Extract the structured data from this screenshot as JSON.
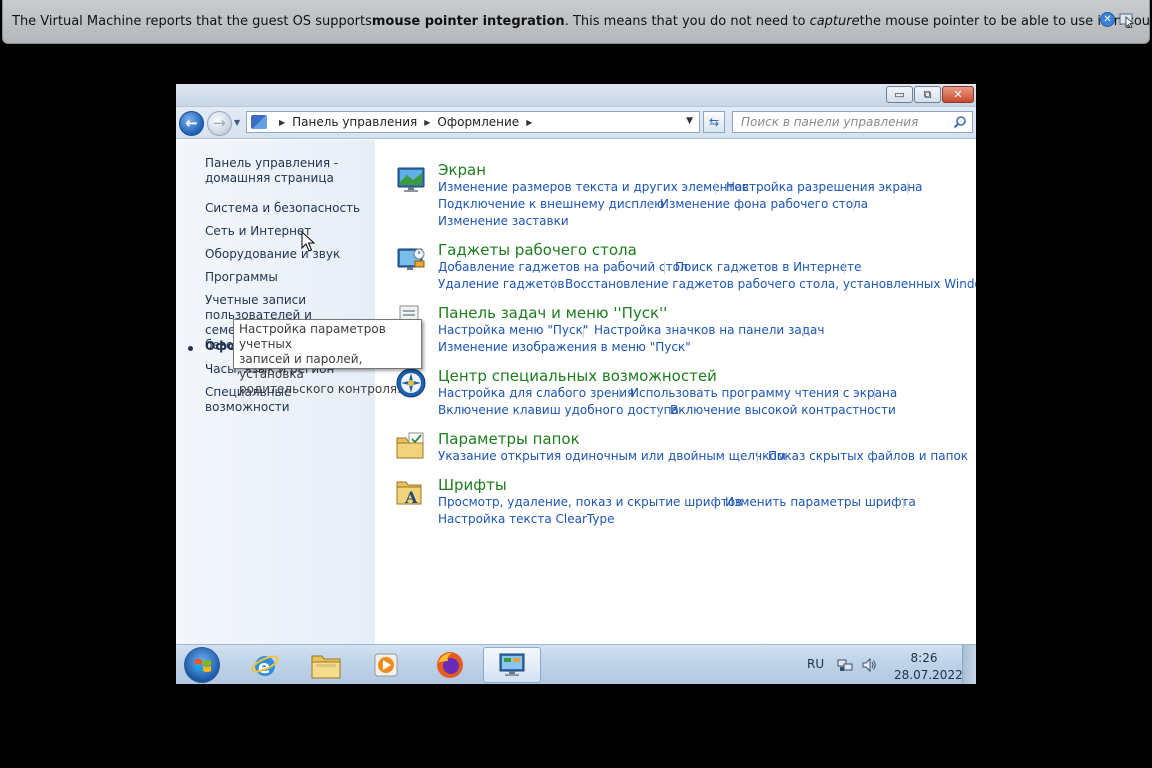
{
  "vbox_banner": {
    "text_before": "The Virtual Machine reports that the guest OS supports ",
    "bold": "mouse pointer integration",
    "text_middle": ". This means that you do not need to ",
    "italic": "capture",
    "text_after": " the mouse pointer to be able to use it in your guest OS –",
    "close_icon": "close-icon",
    "mouse_icon": "mouse-integration-icon"
  },
  "window": {
    "caption": {
      "minimize": "▭",
      "maximize": "⧉",
      "close": "✕"
    },
    "nav": {
      "back": "←",
      "forward": "→",
      "recent": "▼",
      "breadcrumb": [
        "Панель управления",
        "Оформление"
      ],
      "search_placeholder": "Поиск в панели управления"
    },
    "left_pane": {
      "home_line1": "Панель управления -",
      "home_line2": "домашняя страница",
      "items": [
        "Система и безопасность",
        "Сеть и Интернет",
        "Оборудование и звук",
        "Программы",
        "Учетные записи",
        "пользователей и семейная",
        "безо",
        "Офор",
        "Часы, язык и регион",
        "Специальные возможности"
      ]
    },
    "sections": [
      {
        "title": "Экран",
        "links": [
          "Изменение размеров текста и других элементов",
          "Настройка разрешения экрана",
          "Подключение к внешнему дисплею",
          "Изменение фона рабочего стола",
          "Изменение заставки"
        ]
      },
      {
        "title": "Гаджеты рабочего стола",
        "links": [
          "Добавление гаджетов на рабочий стол",
          "Поиск гаджетов в Интернете",
          "Удаление гаджетов",
          "Восстановление гаджетов рабочего стола, установленных Windows"
        ]
      },
      {
        "title": "Панель задач и меню ''Пуск''",
        "links": [
          "Настройка меню \"Пуск\"",
          "Настройка значков на панели задач",
          "Изменение изображения в меню \"Пуск\""
        ]
      },
      {
        "title": "Центр специальных возможностей",
        "links": [
          "Настройка для слабого зрения",
          "Использовать программу чтения с экрана",
          "Включение клавиш удобного доступа",
          "Включение высокой контрастности"
        ]
      },
      {
        "title": "Параметры папок",
        "links": [
          "Указание открытия одиночным или двойным щелчком",
          "Показ скрытых файлов и папок"
        ]
      },
      {
        "title": "Шрифты",
        "links": [
          "Просмотр, удаление, показ и скрытие шрифтов",
          "Изменить параметры шрифта",
          "Настройка текста ClearType"
        ]
      }
    ],
    "tooltip": {
      "line1": "Настройка параметров учетных",
      "line2": "записей и паролей, установка",
      "line3": "родительского контроля."
    }
  },
  "taskbar": {
    "apps": [
      "internet-explorer-icon",
      "explorer-icon",
      "media-player-icon",
      "firefox-icon",
      "control-panel-icon"
    ],
    "lang": "RU",
    "time": "8:26",
    "date": "28.07.2022"
  },
  "colors": {
    "title_green": "#1d7d1d",
    "link_blue": "#1c55b3",
    "nav_text": "#1e3250"
  }
}
